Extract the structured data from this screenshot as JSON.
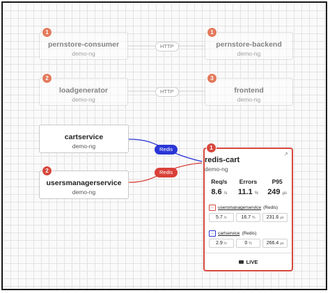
{
  "nodes": [
    {
      "id": "pernstore-consumer",
      "title": "pernstore-consumer",
      "ns": "demo-ng",
      "badge": "1"
    },
    {
      "id": "pernstore-backend",
      "title": "pernstore-backend",
      "ns": "demo-ng",
      "badge": "1"
    },
    {
      "id": "loadgenerator",
      "title": "loadgenerator",
      "ns": "demo-ng",
      "badge": "2"
    },
    {
      "id": "frontend",
      "title": "frontend",
      "ns": "demo-ng",
      "badge": "3"
    },
    {
      "id": "cartservice",
      "title": "cartservice",
      "ns": "demo-ng"
    },
    {
      "id": "usersmanagerservice",
      "title": "usersmanagerservice",
      "ns": "demo-ng",
      "badge": "2"
    }
  ],
  "edges": {
    "http1": "HTTP",
    "http2": "HTTP",
    "redis_blue": "Redis",
    "redis_red": "Redis"
  },
  "detail": {
    "title": "redis-cart",
    "ns": "demo-ng",
    "badge": "1",
    "heads": [
      "Req/s",
      "Errors",
      "P95"
    ],
    "vals": [
      {
        "v": "8.6",
        "u": "/s"
      },
      {
        "v": "11.1",
        "u": "%"
      },
      {
        "v": "249",
        "u": "µs"
      }
    ],
    "connections": [
      {
        "name": "usersmanagerservice",
        "proto": "(Redis)",
        "cells": [
          {
            "v": "5.7",
            "u": "/s"
          },
          {
            "v": "16.7",
            "u": "%"
          },
          {
            "v": "231.6",
            "u": "µs"
          }
        ]
      },
      {
        "name": "cartservice",
        "proto": "(Redis)",
        "cells": [
          {
            "v": "2.9",
            "u": "/s"
          },
          {
            "v": "0",
            "u": "%"
          },
          {
            "v": "266.4",
            "u": "µs"
          }
        ]
      }
    ],
    "live": "LIVE"
  }
}
